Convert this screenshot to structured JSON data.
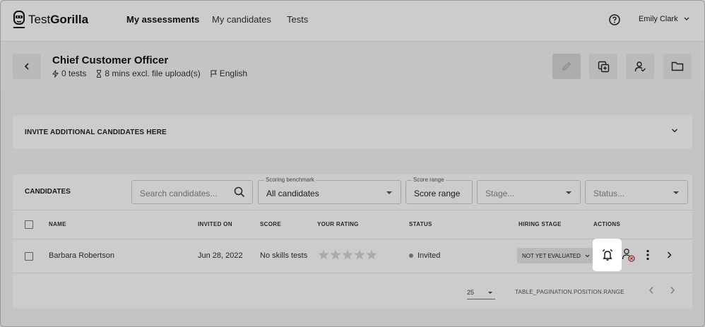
{
  "brand": {
    "name_light": "Test",
    "name_bold": "Gorilla"
  },
  "nav": {
    "links": [
      "My assessments",
      "My candidates",
      "Tests"
    ],
    "user_name": "Emily Clark"
  },
  "assessment": {
    "title": "Chief Customer Officer",
    "tests_count": "0 tests",
    "duration": "8 mins excl. file upload(s)",
    "language": "English"
  },
  "invite": {
    "label": "INVITE ADDITIONAL CANDIDATES HERE"
  },
  "candidates": {
    "title": "CANDIDATES",
    "search_placeholder": "Search candidates...",
    "benchmark_label": "Scoring benchmark",
    "benchmark_value": "All candidates",
    "score_range_label": "Score range",
    "score_range_value": "Score range",
    "stage_placeholder": "Stage...",
    "status_placeholder": "Status...",
    "columns": [
      "NAME",
      "INVITED ON",
      "SCORE",
      "YOUR RATING",
      "STATUS",
      "HIRING STAGE",
      "ACTIONS"
    ],
    "rows": [
      {
        "name": "Barbara Robertson",
        "invited_on": "Jun 28, 2022",
        "score": "No skills tests",
        "rating": 0,
        "status": "Invited",
        "hiring_stage": "NOT YET EVALUATED"
      }
    ],
    "pagination": {
      "page_size": "25",
      "range": "TABLE_PAGINATION.POSITION.RANGE"
    }
  },
  "colors": {
    "overlay": "#00000033",
    "brand_dark": "#111111"
  }
}
